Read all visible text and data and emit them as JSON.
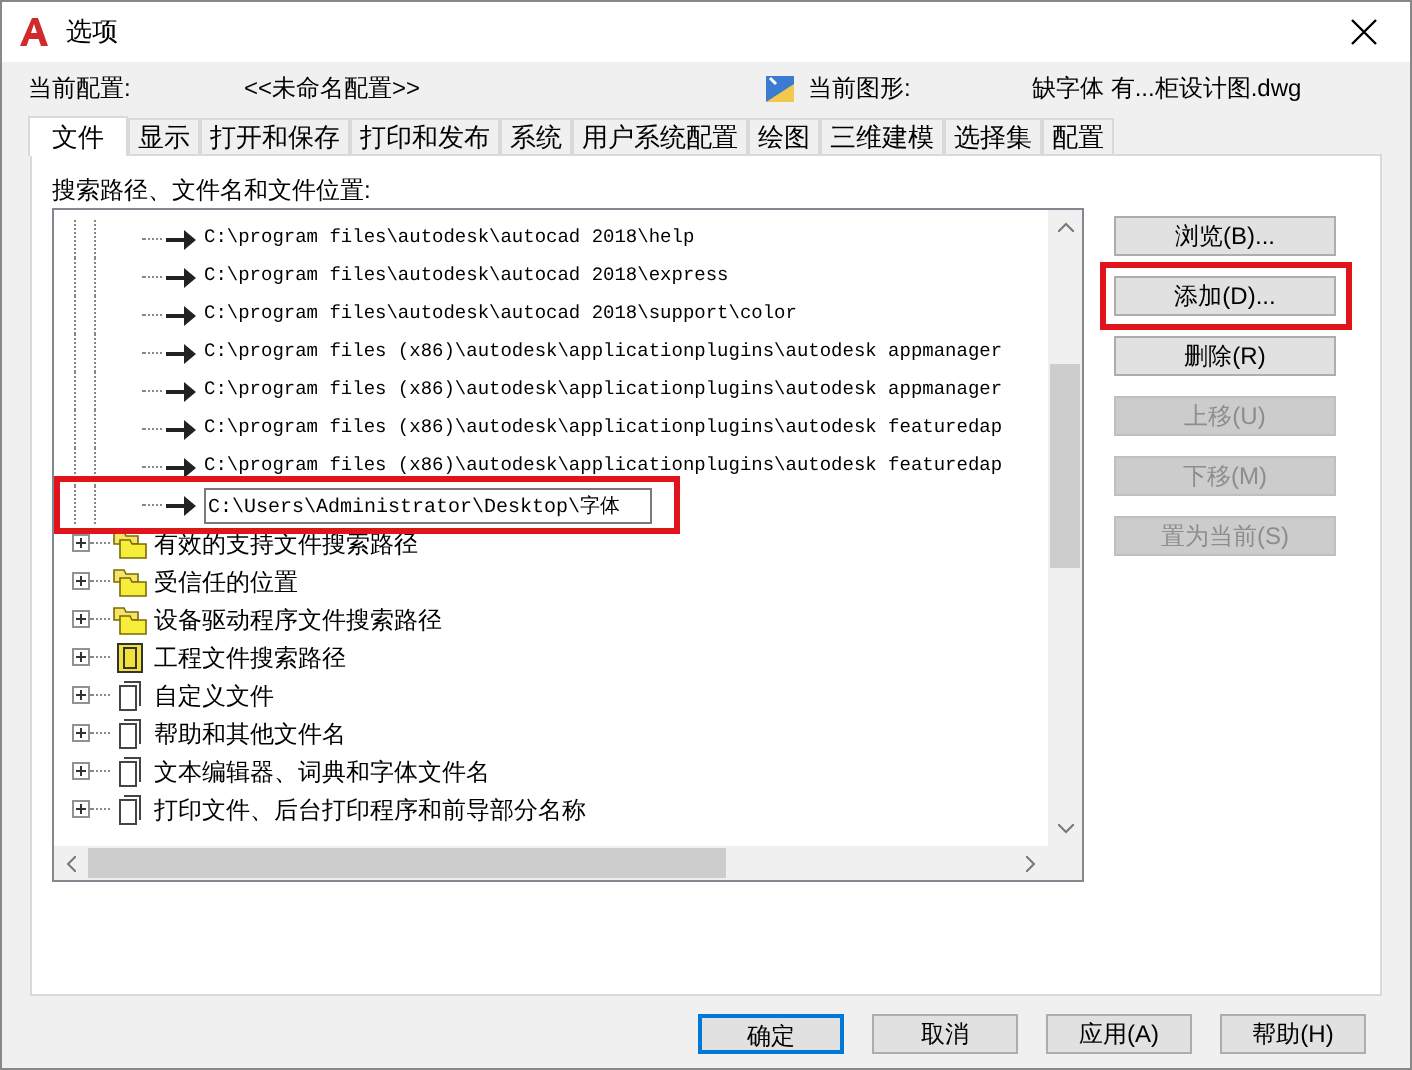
{
  "window": {
    "title": "选项"
  },
  "profile": {
    "label": "当前配置:",
    "value": "<<未命名配置>>",
    "drawing_label": "当前图形:",
    "drawing_value": "缺字体 有...柜设计图.dwg"
  },
  "tabs": [
    {
      "label": "文件",
      "selected": true
    },
    {
      "label": "显示",
      "selected": false
    },
    {
      "label": "打开和保存",
      "selected": false
    },
    {
      "label": "打印和发布",
      "selected": false
    },
    {
      "label": "系统",
      "selected": false
    },
    {
      "label": "用户系统配置",
      "selected": false
    },
    {
      "label": "绘图",
      "selected": false
    },
    {
      "label": "三维建模",
      "selected": false
    },
    {
      "label": "选择集",
      "selected": false
    },
    {
      "label": "配置",
      "selected": false
    }
  ],
  "tree": {
    "label": "搜索路径、文件名和文件位置:",
    "items": [
      {
        "kind": "path",
        "text": "C:\\program files\\autodesk\\autocad 2018\\help"
      },
      {
        "kind": "path",
        "text": "C:\\program files\\autodesk\\autocad 2018\\express"
      },
      {
        "kind": "path",
        "text": "C:\\program files\\autodesk\\autocad 2018\\support\\color"
      },
      {
        "kind": "path",
        "text": "C:\\program files (x86)\\autodesk\\applicationplugins\\autodesk appmanager"
      },
      {
        "kind": "path",
        "text": "C:\\program files (x86)\\autodesk\\applicationplugins\\autodesk appmanager"
      },
      {
        "kind": "path",
        "text": "C:\\program files (x86)\\autodesk\\applicationplugins\\autodesk featuredap"
      },
      {
        "kind": "path",
        "text": "C:\\program files (x86)\\autodesk\\applicationplugins\\autodesk featuredap"
      },
      {
        "kind": "edit",
        "value": "C:\\Users\\Administrator\\Desktop\\字体",
        "highlighted": true
      },
      {
        "kind": "folders",
        "text": "有效的支持文件搜索路径",
        "expanded": false
      },
      {
        "kind": "folders",
        "text": "受信任的位置",
        "expanded": false
      },
      {
        "kind": "folders",
        "text": "设备驱动程序文件搜索路径",
        "expanded": false
      },
      {
        "kind": "book",
        "text": "工程文件搜索路径",
        "expanded": false
      },
      {
        "kind": "file",
        "text": "自定义文件",
        "expanded": false
      },
      {
        "kind": "file",
        "text": "帮助和其他文件名",
        "expanded": false
      },
      {
        "kind": "file",
        "text": "文本编辑器、词典和字体文件名",
        "expanded": false
      },
      {
        "kind": "file",
        "text": "打印文件、后台打印程序和前导部分名称",
        "expanded": false
      }
    ]
  },
  "side_buttons": [
    {
      "label": "浏览(B)...",
      "disabled": false,
      "highlighted": false
    },
    {
      "label": "添加(D)...",
      "disabled": false,
      "highlighted": true
    },
    {
      "label": "删除(R)",
      "disabled": false,
      "highlighted": false
    },
    {
      "label": "上移(U)",
      "disabled": true,
      "highlighted": false
    },
    {
      "label": "下移(M)",
      "disabled": true,
      "highlighted": false
    },
    {
      "label": "置为当前(S)",
      "disabled": true,
      "highlighted": false
    }
  ],
  "footer_buttons": [
    {
      "label": "确定",
      "default": true
    },
    {
      "label": "取消",
      "default": false
    },
    {
      "label": "应用(A)",
      "default": false
    },
    {
      "label": "帮助(H)",
      "default": false
    }
  ]
}
